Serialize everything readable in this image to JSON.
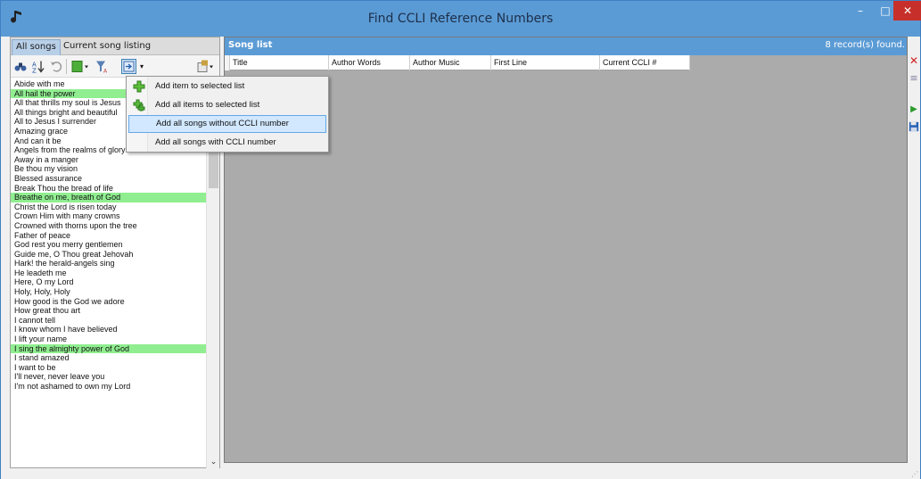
{
  "window": {
    "title": "Find CCLI Reference Numbers",
    "controls": [
      "–",
      "□",
      "✕"
    ]
  },
  "left": {
    "tabs": [
      "All songs",
      "Current song listing"
    ],
    "toolbar_icons": [
      "binoculars-icon",
      "sort-az-icon",
      "undo-icon",
      "green-box-dropdown-icon",
      "filter-icon",
      "add-items-dropdown-icon",
      "options-icon"
    ],
    "songs": [
      {
        "title": "Abide with me",
        "hl": false
      },
      {
        "title": "All hail the power",
        "hl": true
      },
      {
        "title": "All that thrills my soul is Jesus",
        "hl": false
      },
      {
        "title": "All things bright and beautiful",
        "hl": false
      },
      {
        "title": "All to Jesus I surrender",
        "hl": false
      },
      {
        "title": "Amazing grace",
        "hl": false
      },
      {
        "title": "And can it be",
        "hl": false
      },
      {
        "title": "Angels from the realms of glory",
        "hl": false
      },
      {
        "title": "Away in a manger",
        "hl": false
      },
      {
        "title": "Be thou my vision",
        "hl": false
      },
      {
        "title": "Blessed assurance",
        "hl": false
      },
      {
        "title": "Break Thou the bread of life",
        "hl": false
      },
      {
        "title": "Breathe on me, breath of God",
        "hl": true
      },
      {
        "title": "Christ the Lord is risen today",
        "hl": false
      },
      {
        "title": "Crown Him with many crowns",
        "hl": false
      },
      {
        "title": "Crowned with thorns upon the tree",
        "hl": false
      },
      {
        "title": "Father of peace",
        "hl": false
      },
      {
        "title": "God rest you merry gentlemen",
        "hl": false
      },
      {
        "title": "Guide me, O Thou great Jehovah",
        "hl": false
      },
      {
        "title": "Hark! the herald-angels sing",
        "hl": false
      },
      {
        "title": "He leadeth me",
        "hl": false
      },
      {
        "title": "Here, O my Lord",
        "hl": false
      },
      {
        "title": "Holy, Holy, Holy",
        "hl": false
      },
      {
        "title": "How good is the God we adore",
        "hl": false
      },
      {
        "title": "How great thou art",
        "hl": false
      },
      {
        "title": "I cannot tell",
        "hl": false
      },
      {
        "title": "I know whom I have believed",
        "hl": false
      },
      {
        "title": "I lift your name",
        "hl": false
      },
      {
        "title": "I sing the almighty power of God",
        "hl": true
      },
      {
        "title": "I stand amazed",
        "hl": false
      },
      {
        "title": "I want to be",
        "hl": false
      },
      {
        "title": "I'll never, never leave you",
        "hl": false
      },
      {
        "title": "I'm not ashamed to own my Lord",
        "hl": false
      }
    ]
  },
  "menu": {
    "items": [
      "Add item to selected list",
      "Add all items to selected list",
      "Add all songs without CCLI number",
      "Add all songs with CCLI number"
    ]
  },
  "right": {
    "header_title": "Song list",
    "record_count": "8 record(s) found.",
    "columns": [
      "Title",
      "Author Words",
      "Author Music",
      "First Line",
      "Current CCLI #"
    ]
  },
  "colors": {
    "titlebar": "#5b9bd5",
    "highlight_song": "#90ee90",
    "grid_bg": "#ababab",
    "menu_hover": "#d1e8ff"
  }
}
